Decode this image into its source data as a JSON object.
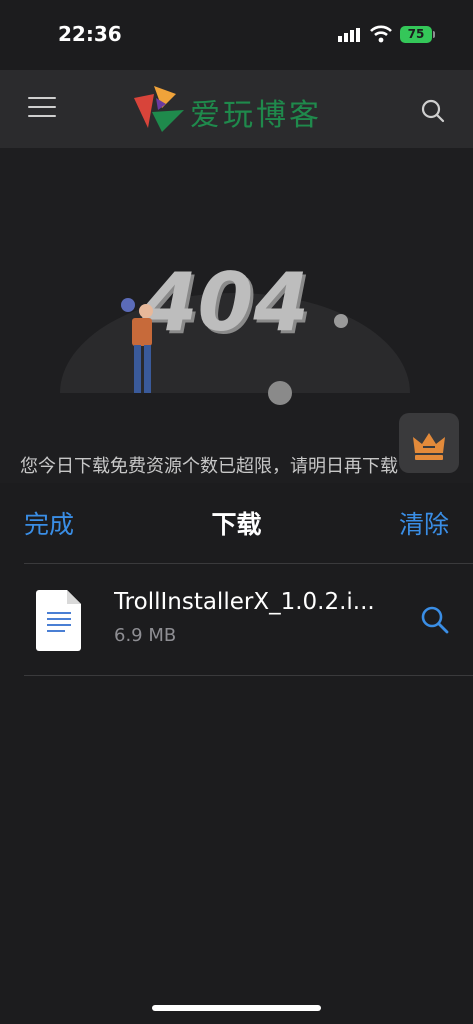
{
  "status": {
    "time": "22:36",
    "battery": "75"
  },
  "site": {
    "logo_text": "爱玩博客",
    "notice": "您今日下载免费资源个数已超限，请明日再下载"
  },
  "downloads": {
    "done_label": "完成",
    "title": "下载",
    "clear_label": "清除",
    "items": [
      {
        "name": "TrollInstallerX_1.0.2.i...",
        "size": "6.9 MB"
      }
    ]
  },
  "colors": {
    "accent": "#3a8ee6",
    "battery": "#34c759",
    "logo": "#1f8a4c"
  }
}
